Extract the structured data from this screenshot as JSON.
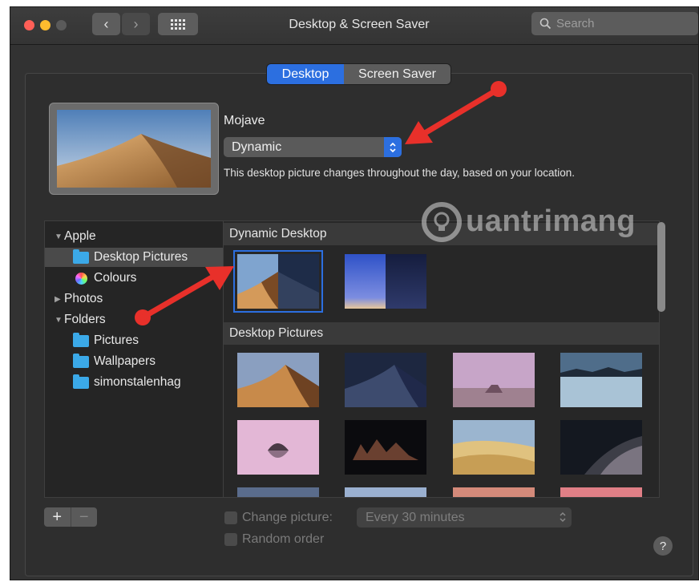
{
  "window": {
    "title": "Desktop & Screen Saver",
    "back_glyph": "‹",
    "forward_glyph": "›",
    "search_placeholder": "Search"
  },
  "tabs": [
    {
      "label": "Desktop",
      "active": true
    },
    {
      "label": "Screen Saver",
      "active": false
    }
  ],
  "current": {
    "name": "Mojave",
    "mode": "Dynamic",
    "description": "This desktop picture changes throughout the day, based on your location."
  },
  "sidebar": {
    "items": [
      {
        "label": "Apple",
        "kind": "group",
        "expanded": true
      },
      {
        "label": "Desktop Pictures",
        "kind": "folder",
        "selected": true
      },
      {
        "label": "Colours",
        "kind": "colour-wheel"
      },
      {
        "label": "Photos",
        "kind": "group",
        "expanded": false
      },
      {
        "label": "Folders",
        "kind": "group",
        "expanded": true
      },
      {
        "label": "Pictures",
        "kind": "folder"
      },
      {
        "label": "Wallpapers",
        "kind": "folder"
      },
      {
        "label": "simonstalenhag",
        "kind": "folder"
      }
    ]
  },
  "sections": {
    "dynamic_title": "Dynamic Desktop",
    "pictures_title": "Desktop Pictures"
  },
  "buttons": {
    "add": "+",
    "remove": "−",
    "help": "?"
  },
  "options": {
    "change_picture_label": "Change picture:",
    "interval_value": "Every 30 minutes",
    "random_order_label": "Random order"
  },
  "watermark": {
    "text": "uantrimang"
  },
  "colors": {
    "accent": "#2c6fe0",
    "annotation_arrow": "#e8302a",
    "window_bg": "#323232"
  }
}
